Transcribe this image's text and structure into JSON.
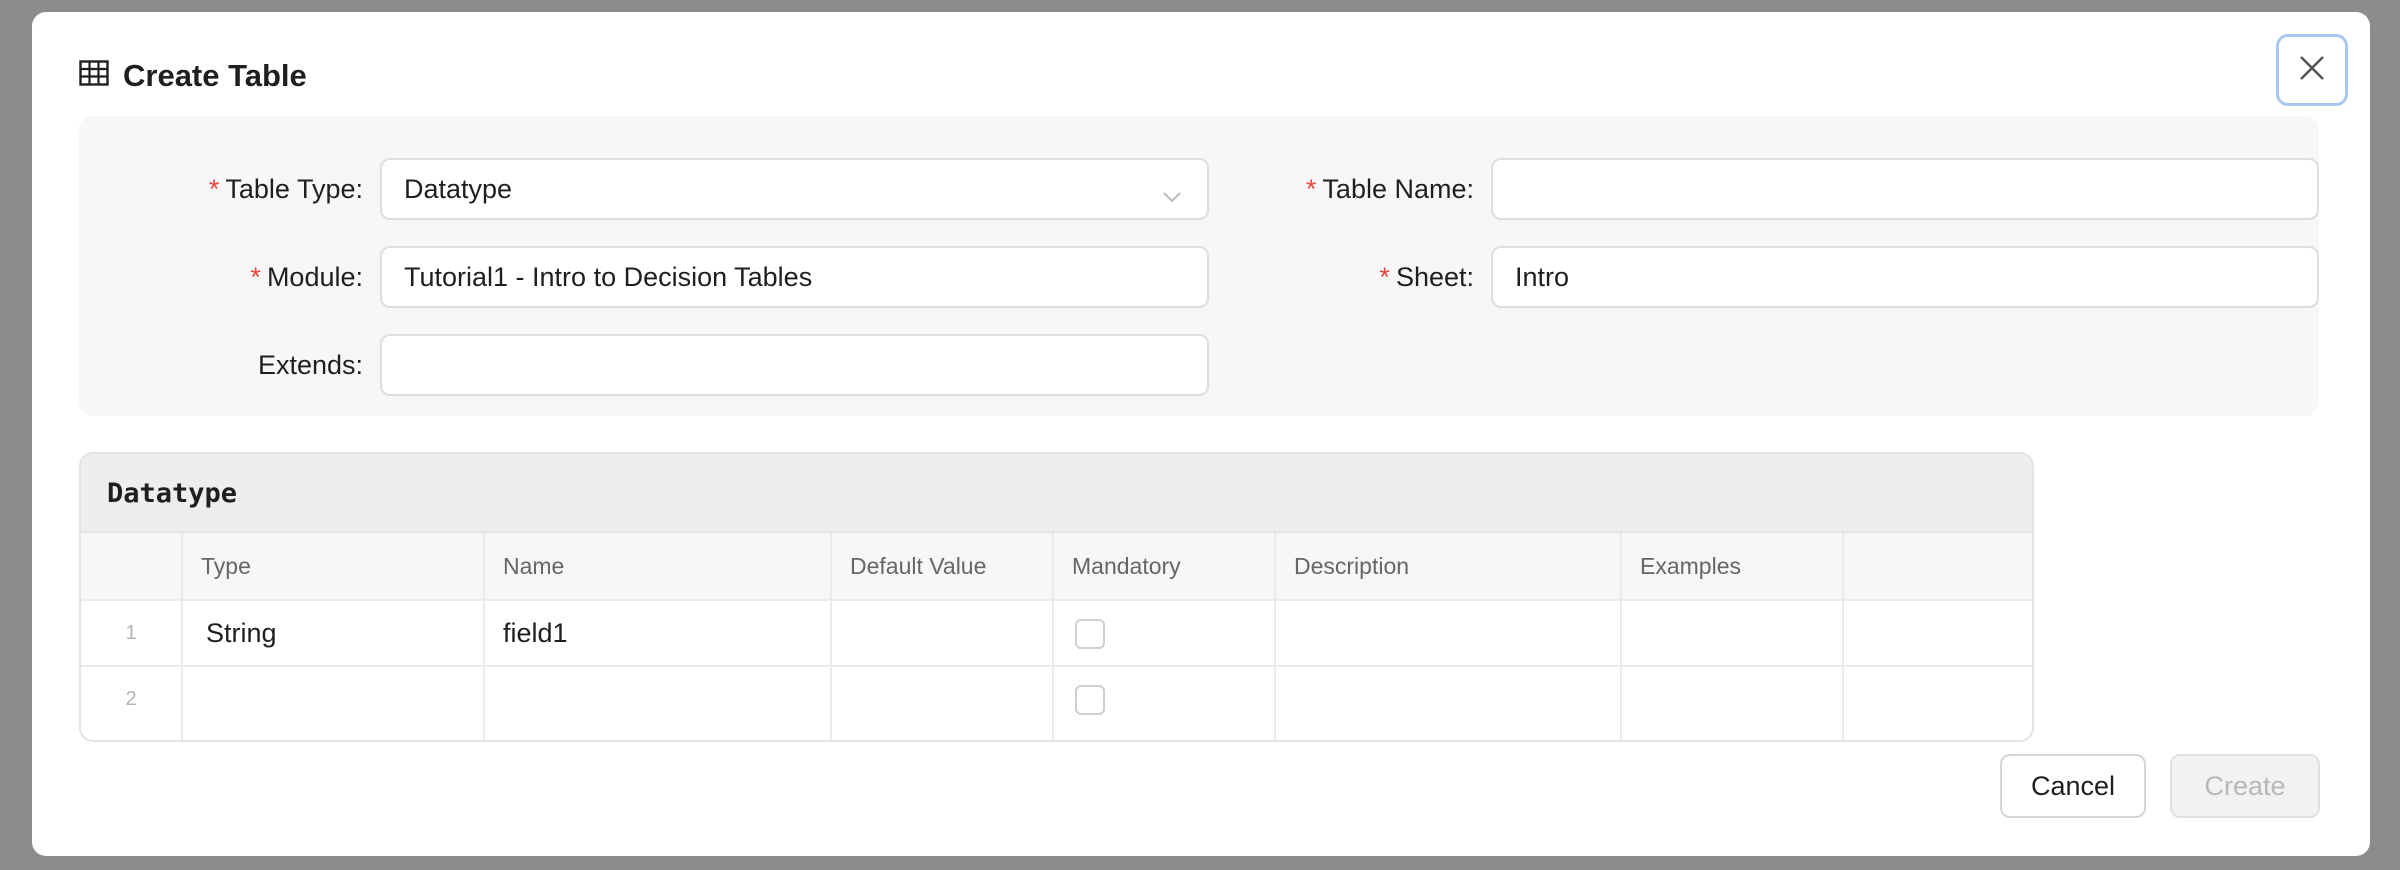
{
  "dialog": {
    "title": "Create Table",
    "title_icon": "table-icon",
    "close_icon": "close-icon"
  },
  "form": {
    "table_type": {
      "label": "Table Type:",
      "value": "Datatype",
      "required": true
    },
    "table_name": {
      "label": "Table Name:",
      "value": "",
      "required": true
    },
    "module": {
      "label": "Module:",
      "value": "Tutorial1 - Intro to Decision Tables",
      "required": true
    },
    "sheet": {
      "label": "Sheet:",
      "value": "Intro",
      "required": true
    },
    "extends": {
      "label": "Extends:",
      "value": "",
      "required": false
    },
    "required_marker": "*"
  },
  "datatype_table": {
    "title": "Datatype",
    "columns": [
      "Type",
      "Name",
      "Default Value",
      "Mandatory",
      "Description",
      "Examples"
    ],
    "rows": [
      {
        "num": "1",
        "type": "String",
        "name": "field1",
        "default": "",
        "mandatory": false,
        "description": "",
        "examples": ""
      },
      {
        "num": "2",
        "type": "",
        "name": "",
        "default": "",
        "mandatory": false,
        "description": "",
        "examples": ""
      }
    ]
  },
  "actions": {
    "cancel_label": "Cancel",
    "create_label": "Create"
  },
  "colors": {
    "required": "#e8463f",
    "focus_border": "#a9c8ef",
    "panel_bg": "#f7f7f7"
  }
}
